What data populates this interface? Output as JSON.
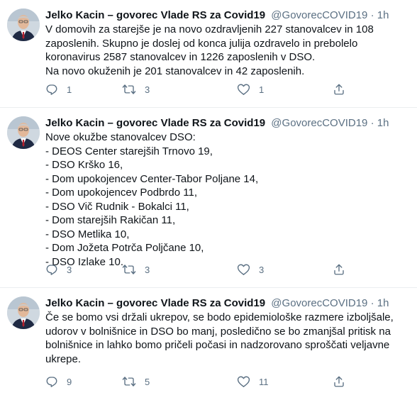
{
  "tweets": [
    {
      "author": "Jelko Kacin – govorec Vlade RS za Covid19",
      "handle": "@GovorecCOVID19",
      "separator": "·",
      "time": "1h",
      "lines": [
        "V domovih za starejše je na novo ozdravljenih 227 stanovalcev in 108",
        "zaposlenih. Skupno je doslej od konca julija ozdravelo in prebolelo",
        "koronavirus 2587 stanovalcev in 1226 zaposlenih v DSO.",
        "Na novo okuženih je 201 stanovalcev in 42 zaposlenih."
      ],
      "replies": "1",
      "retweets": "3",
      "likes": "1"
    },
    {
      "author": "Jelko Kacin – govorec Vlade RS za Covid19",
      "handle": "@GovorecCOVID19",
      "separator": "·",
      "time": "1h",
      "lines": [
        "Nove okužbe stanovalcev DSO:",
        "- DEOS Center starejših Trnovo 19,",
        "- DSO Krško 16,",
        "- Dom upokojencev Center-Tabor Poljane 14,",
        "- Dom upokojencev Podbrdo 11,",
        "- DSO Vič Rudnik - Bokalci 11,",
        "- Dom starejših Rakičan 11,",
        "- DSO Metlika 10,",
        "- Dom Jožeta Potrča Poljčane 10,",
        "- DSO Izlake 10."
      ],
      "replies": "3",
      "retweets": "3",
      "likes": "3"
    },
    {
      "author": "Jelko Kacin – govorec Vlade RS za Covid19",
      "handle": "@GovorecCOVID19",
      "separator": "·",
      "time": "1h",
      "lines": [
        "Če se bomo vsi držali ukrepov, se bodo epidemiološke razmere izboljšale,",
        "udorov v bolnišnice in DSO bo manj, posledično se bo zmanjšal pritisk na",
        "bolnišnice in lahko bomo pričeli počasi in nadzorovano sproščati veljavne",
        "ukrepe."
      ],
      "replies": "9",
      "retweets": "5",
      "likes": "11"
    }
  ],
  "icons": {
    "reply": "reply-icon",
    "retweet": "retweet-icon",
    "like": "heart-icon",
    "share": "share-icon"
  },
  "colors": {
    "text": "#0f1419",
    "secondary": "#5b7083",
    "divider": "#ebeef0"
  }
}
